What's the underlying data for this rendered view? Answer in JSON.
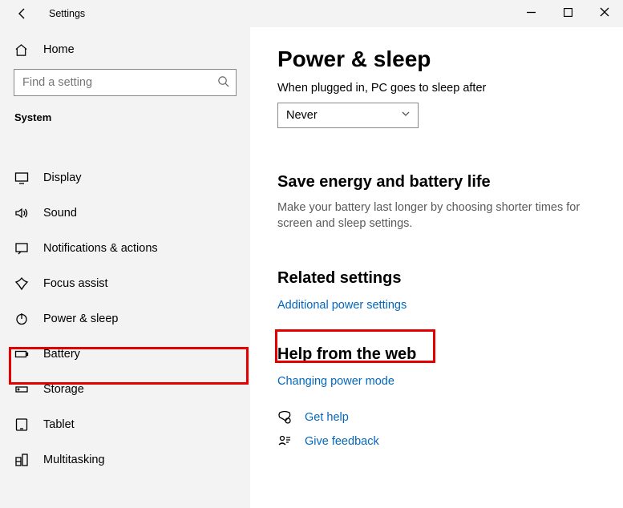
{
  "window": {
    "title": "Settings"
  },
  "sidebar": {
    "home_label": "Home",
    "search_placeholder": "Find a setting",
    "category": "System",
    "items": [
      {
        "label": "Display"
      },
      {
        "label": "Sound"
      },
      {
        "label": "Notifications & actions"
      },
      {
        "label": "Focus assist"
      },
      {
        "label": "Power & sleep"
      },
      {
        "label": "Battery"
      },
      {
        "label": "Storage"
      },
      {
        "label": "Tablet"
      },
      {
        "label": "Multitasking"
      }
    ]
  },
  "main": {
    "title": "Power & sleep",
    "plugged_label": "When plugged in, PC goes to sleep after",
    "plugged_value": "Never",
    "energy_heading": "Save energy and battery life",
    "energy_desc": "Make your battery last longer by choosing shorter times for screen and sleep settings.",
    "related_heading": "Related settings",
    "related_link": "Additional power settings",
    "help_heading": "Help from the web",
    "help_link": "Changing power mode",
    "get_help": "Get help",
    "give_feedback": "Give feedback"
  }
}
